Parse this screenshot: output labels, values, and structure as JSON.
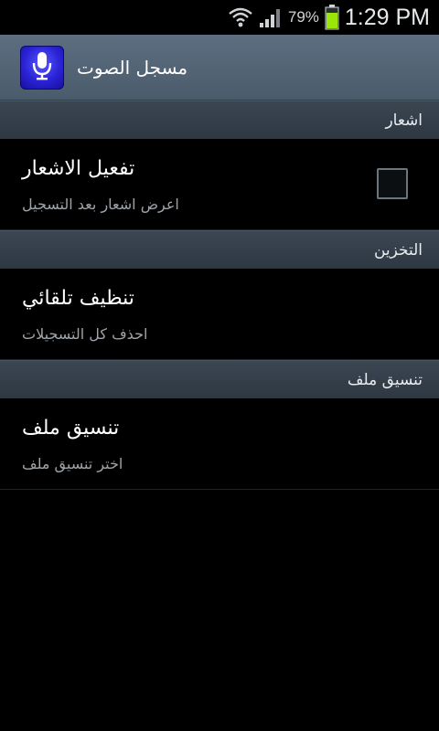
{
  "status_bar": {
    "battery_percent": "79%",
    "time": "1:29 PM"
  },
  "action_bar": {
    "title": "مسجل الصوت"
  },
  "sections": [
    {
      "header": "اشعار",
      "items": [
        {
          "title": "تفعيل الاشعار",
          "summary": "اعرض اشعار بعد التسجيل",
          "checked": false
        }
      ]
    },
    {
      "header": "التخزين",
      "items": [
        {
          "title": "تنظيف تلقائي",
          "summary": "احذف كل التسجيلات"
        }
      ]
    },
    {
      "header": "تنسيق ملف",
      "items": [
        {
          "title": "تنسيق ملف",
          "summary": "اختر تنسيق ملف"
        }
      ]
    }
  ],
  "colors": {
    "action_bar": "#56677a",
    "section_header": "#35404b",
    "battery": "#9be60a",
    "app_icon": "#2a23d6"
  },
  "icons": [
    "wifi-icon",
    "signal-icon",
    "battery-icon",
    "microphone-icon"
  ]
}
